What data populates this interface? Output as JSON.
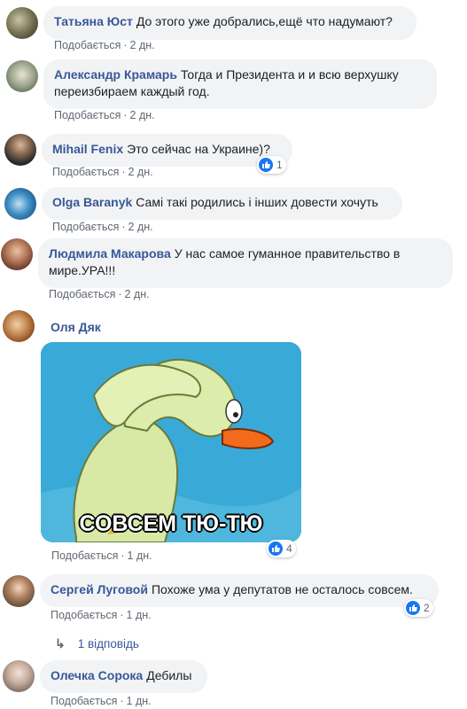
{
  "comments": [
    {
      "author": "Татьяна Юст",
      "text": "До этого уже добрались,ещё что надумают?",
      "like_label": "Подобається",
      "time": "2 дн."
    },
    {
      "author": "Александр Крамарь",
      "text": "Тогда и Президента и и всю верхушку переизбираем каждый год.",
      "like_label": "Подобається",
      "time": "2 дн."
    },
    {
      "author": "Mihail Fenix",
      "text": "Это сейчас на Украине)?",
      "like_label": "Подобається",
      "time": "2 дн.",
      "reactions": "1"
    },
    {
      "author": "Olga Baranyk",
      "text": "Самі такі родились і інших довести хочуть",
      "like_label": "Подобається",
      "time": "2 дн."
    },
    {
      "author": "Людмила Макарова",
      "text": "У нас самое гуманное правительство в мире.УРА!!!",
      "like_label": "Подобається",
      "time": "2 дн."
    },
    {
      "author": "Оля Дяк",
      "image_caption": "СОВСЕМ ТЮ-ТЮ",
      "like_label": "Подобається",
      "time": "1 дн.",
      "reactions": "4"
    },
    {
      "author": "Сергей Луговой",
      "text": "Похоже ума у депутатов не осталось совсем.",
      "like_label": "Подобається",
      "time": "1 дн.",
      "reactions": "2",
      "replies_label": "1 відповідь"
    },
    {
      "author": "Олечка Сорока",
      "text": "Дебилы",
      "like_label": "Подобається",
      "time": "1 дн."
    }
  ],
  "colors": {
    "name": "#385898",
    "bubble": "#f2f3f5",
    "meta": "#606770",
    "like_badge": "#1877f2"
  },
  "icons": {
    "like": "thumbs-up-icon",
    "reply": "reply-arrow-icon"
  }
}
